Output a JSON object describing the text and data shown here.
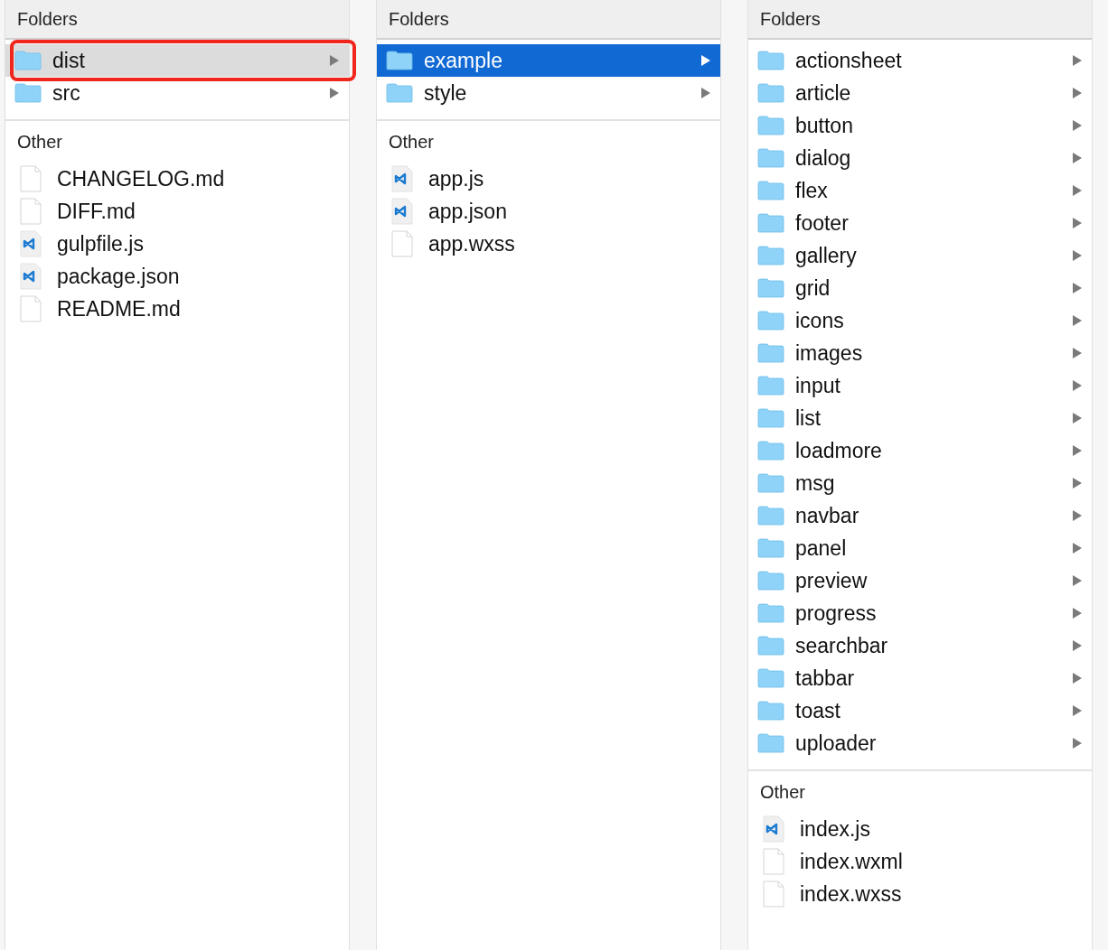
{
  "columns": [
    {
      "kind": "inactive",
      "folders_heading": "Folders",
      "folders": [
        {
          "name": "dist",
          "selected": true,
          "outlined": true
        },
        {
          "name": "src",
          "selected": false,
          "outlined": false
        }
      ],
      "other_heading": "Other",
      "files": [
        {
          "name": "CHANGELOG.md",
          "kind": "plain"
        },
        {
          "name": "DIFF.md",
          "kind": "plain"
        },
        {
          "name": "gulpfile.js",
          "kind": "vscode"
        },
        {
          "name": "package.json",
          "kind": "vscode"
        },
        {
          "name": "README.md",
          "kind": "plain"
        }
      ]
    },
    {
      "kind": "active",
      "folders_heading": "Folders",
      "folders": [
        {
          "name": "example",
          "selected": true,
          "outlined": false
        },
        {
          "name": "style",
          "selected": false,
          "outlined": false
        }
      ],
      "other_heading": "Other",
      "files": [
        {
          "name": "app.js",
          "kind": "vscode"
        },
        {
          "name": "app.json",
          "kind": "vscode"
        },
        {
          "name": "app.wxss",
          "kind": "plain"
        }
      ]
    },
    {
      "folders_heading": "Folders",
      "folders": [
        {
          "name": "actionsheet",
          "selected": false,
          "outlined": false
        },
        {
          "name": "article",
          "selected": false,
          "outlined": false
        },
        {
          "name": "button",
          "selected": false,
          "outlined": false
        },
        {
          "name": "dialog",
          "selected": false,
          "outlined": false
        },
        {
          "name": "flex",
          "selected": false,
          "outlined": false
        },
        {
          "name": "footer",
          "selected": false,
          "outlined": false
        },
        {
          "name": "gallery",
          "selected": false,
          "outlined": false
        },
        {
          "name": "grid",
          "selected": false,
          "outlined": false
        },
        {
          "name": "icons",
          "selected": false,
          "outlined": false
        },
        {
          "name": "images",
          "selected": false,
          "outlined": false
        },
        {
          "name": "input",
          "selected": false,
          "outlined": false
        },
        {
          "name": "list",
          "selected": false,
          "outlined": false
        },
        {
          "name": "loadmore",
          "selected": false,
          "outlined": false
        },
        {
          "name": "msg",
          "selected": false,
          "outlined": false
        },
        {
          "name": "navbar",
          "selected": false,
          "outlined": false
        },
        {
          "name": "panel",
          "selected": false,
          "outlined": false
        },
        {
          "name": "preview",
          "selected": false,
          "outlined": false
        },
        {
          "name": "progress",
          "selected": false,
          "outlined": false
        },
        {
          "name": "searchbar",
          "selected": false,
          "outlined": false
        },
        {
          "name": "tabbar",
          "selected": false,
          "outlined": false
        },
        {
          "name": "toast",
          "selected": false,
          "outlined": false
        },
        {
          "name": "uploader",
          "selected": false,
          "outlined": false
        }
      ],
      "other_heading": "Other",
      "files": [
        {
          "name": "index.js",
          "kind": "vscode"
        },
        {
          "name": "index.wxml",
          "kind": "plain"
        },
        {
          "name": "index.wxss",
          "kind": "plain"
        }
      ]
    }
  ]
}
